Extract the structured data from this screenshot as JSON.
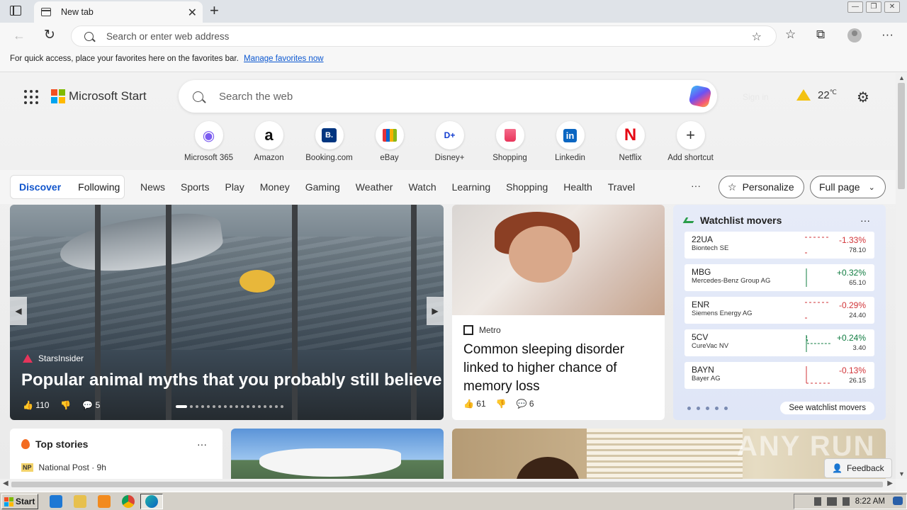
{
  "browser": {
    "tab_title": "New tab",
    "address_placeholder": "Search or enter web address",
    "favorites_bar_text": "For quick access, place your favorites here on the favorites bar.",
    "favorites_bar_link": "Manage favorites now"
  },
  "header": {
    "brand": "Microsoft Start",
    "search_placeholder": "Search the web",
    "signin": "Sign in",
    "temperature": "22",
    "temp_unit": "℃"
  },
  "shortcuts": [
    {
      "label": "Microsoft 365",
      "glyph": "◉",
      "color": "#7b5cf0"
    },
    {
      "label": "Amazon",
      "glyph": "a",
      "color": "#111111"
    },
    {
      "label": "Booking.com",
      "glyph": "B.",
      "color": "#ffffff"
    },
    {
      "label": "eBay",
      "glyph": "▮",
      "color": "#e53238"
    },
    {
      "label": "Disney+",
      "glyph": "D+",
      "color": "#113ccf"
    },
    {
      "label": "Shopping",
      "glyph": "◆",
      "color": "#e8345a"
    },
    {
      "label": "Linkedin",
      "glyph": "in",
      "color": "#ffffff"
    },
    {
      "label": "Netflix",
      "glyph": "N",
      "color": "#e50914"
    },
    {
      "label": "Add shortcut",
      "glyph": "+",
      "color": "#333333"
    }
  ],
  "feed": {
    "discover": "Discover",
    "following": "Following",
    "categories": [
      "News",
      "Sports",
      "Play",
      "Money",
      "Gaming",
      "Weather",
      "Watch",
      "Learning",
      "Shopping",
      "Health",
      "Travel"
    ],
    "more": "···",
    "personalize": "Personalize",
    "full_page": "Full page"
  },
  "hero": {
    "source": "StarsInsider",
    "title": "Popular animal myths that you probably still believe",
    "likes": "110",
    "comments": "5"
  },
  "article2": {
    "source": "Metro",
    "title": "Common sleeping disorder linked to higher chance of memory loss",
    "likes": "61",
    "comments": "6"
  },
  "watchlist": {
    "title": "Watchlist movers",
    "see_all": "See watchlist movers",
    "up_color": "#107c41",
    "down_color": "#d13438",
    "stocks": [
      {
        "symbol": "22UA",
        "name": "Biontech SE",
        "change": "-1.33%",
        "price": "78.10",
        "direction": "down"
      },
      {
        "symbol": "MBG",
        "name": "Mercedes-Benz Group AG",
        "change": "+0.32%",
        "price": "65.10",
        "direction": "up"
      },
      {
        "symbol": "ENR",
        "name": "Siemens Energy AG",
        "change": "-0.29%",
        "price": "24.40",
        "direction": "down"
      },
      {
        "symbol": "5CV",
        "name": "CureVac NV",
        "change": "+0.24%",
        "price": "3.40",
        "direction": "up"
      },
      {
        "symbol": "BAYN",
        "name": "Bayer AG",
        "change": "-0.13%",
        "price": "26.15",
        "direction": "down"
      }
    ]
  },
  "top_stories": {
    "title": "Top stories",
    "source_badge": "NP",
    "source": "National Post · 9h"
  },
  "feedback": "Feedback",
  "watermark": "ANY RUN",
  "taskbar": {
    "start": "Start",
    "time": "8:22 AM"
  }
}
